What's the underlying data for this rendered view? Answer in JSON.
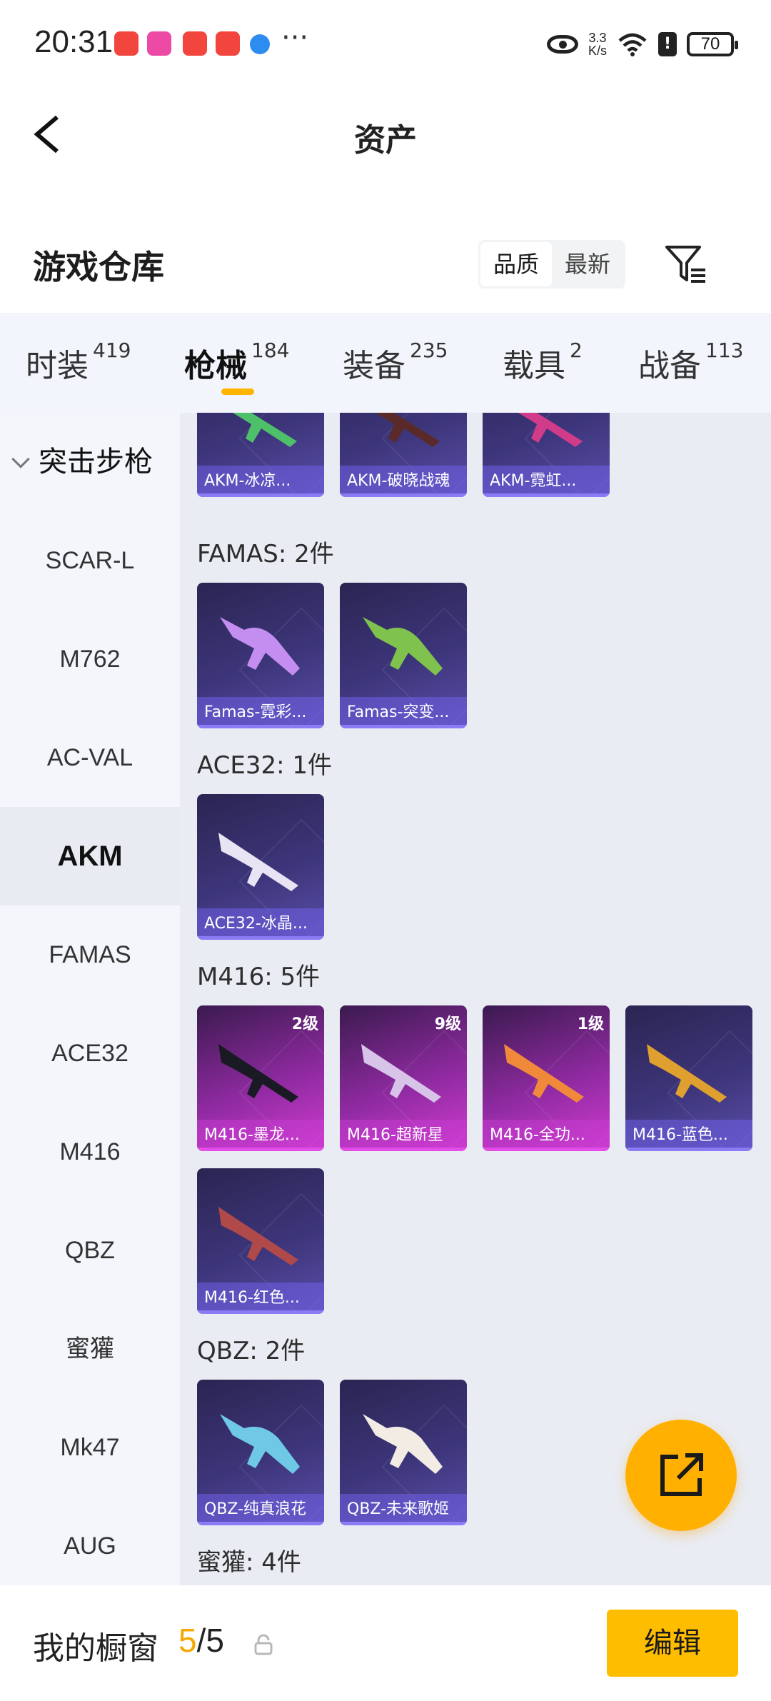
{
  "status_bar": {
    "time": "20:31",
    "more": "···",
    "net_speed_value": "3.3",
    "net_speed_unit": "K/s",
    "battery": "70"
  },
  "header": {
    "title": "资产"
  },
  "warehouse": {
    "title": "游戏仓库",
    "sort": [
      "品质",
      "最新"
    ],
    "sort_selected": "品质"
  },
  "tabs": [
    {
      "label": "时装",
      "count": "419"
    },
    {
      "label": "枪械",
      "count": "184"
    },
    {
      "label": "装备",
      "count": "235"
    },
    {
      "label": "载具",
      "count": "2"
    },
    {
      "label": "战备",
      "count": "113"
    }
  ],
  "tab_selected": "枪械",
  "sidebar": {
    "group": "突击步枪",
    "items": [
      "SCAR-L",
      "M762",
      "AC-VAL",
      "AKM",
      "FAMAS",
      "ACE32",
      "M416",
      "QBZ",
      "蜜獾",
      "Mk47",
      "AUG"
    ],
    "selected": "AKM"
  },
  "groups": [
    {
      "items": [
        {
          "name": "AKM-冰凉...",
          "rarity": "purple"
        },
        {
          "name": "AKM-破晓战魂",
          "rarity": "purple"
        },
        {
          "name": "AKM-霓虹...",
          "rarity": "purple"
        }
      ]
    },
    {
      "title": "FAMAS: 2件",
      "items": [
        {
          "name": "Famas-霓彩...",
          "rarity": "purple"
        },
        {
          "name": "Famas-突变...",
          "rarity": "purple"
        }
      ]
    },
    {
      "title": "ACE32: 1件",
      "items": [
        {
          "name": "ACE32-冰晶...",
          "rarity": "purple"
        }
      ]
    },
    {
      "title": "M416: 5件",
      "items": [
        {
          "name": "M416-墨龙...",
          "rarity": "pink",
          "level": "2级"
        },
        {
          "name": "M416-超新星",
          "rarity": "pink",
          "level": "9级"
        },
        {
          "name": "M416-全功...",
          "rarity": "pink",
          "level": "1级"
        },
        {
          "name": "M416-蓝色...",
          "rarity": "purple"
        },
        {
          "name": "M416-红色...",
          "rarity": "purple"
        }
      ]
    },
    {
      "title": "QBZ: 2件",
      "items": [
        {
          "name": "QBZ-纯真浪花",
          "rarity": "purple"
        },
        {
          "name": "QBZ-未来歌姬",
          "rarity": "purple"
        }
      ]
    },
    {
      "title": "蜜獾: 4件",
      "items": []
    }
  ],
  "bottom": {
    "label": "我的橱窗",
    "used": "5",
    "separator": "/",
    "total": "5",
    "edit_label": "编辑"
  },
  "colors": {
    "accent": "#ffb400",
    "purple_card": "#3d357a",
    "pink_card": "#8e2aa0"
  }
}
